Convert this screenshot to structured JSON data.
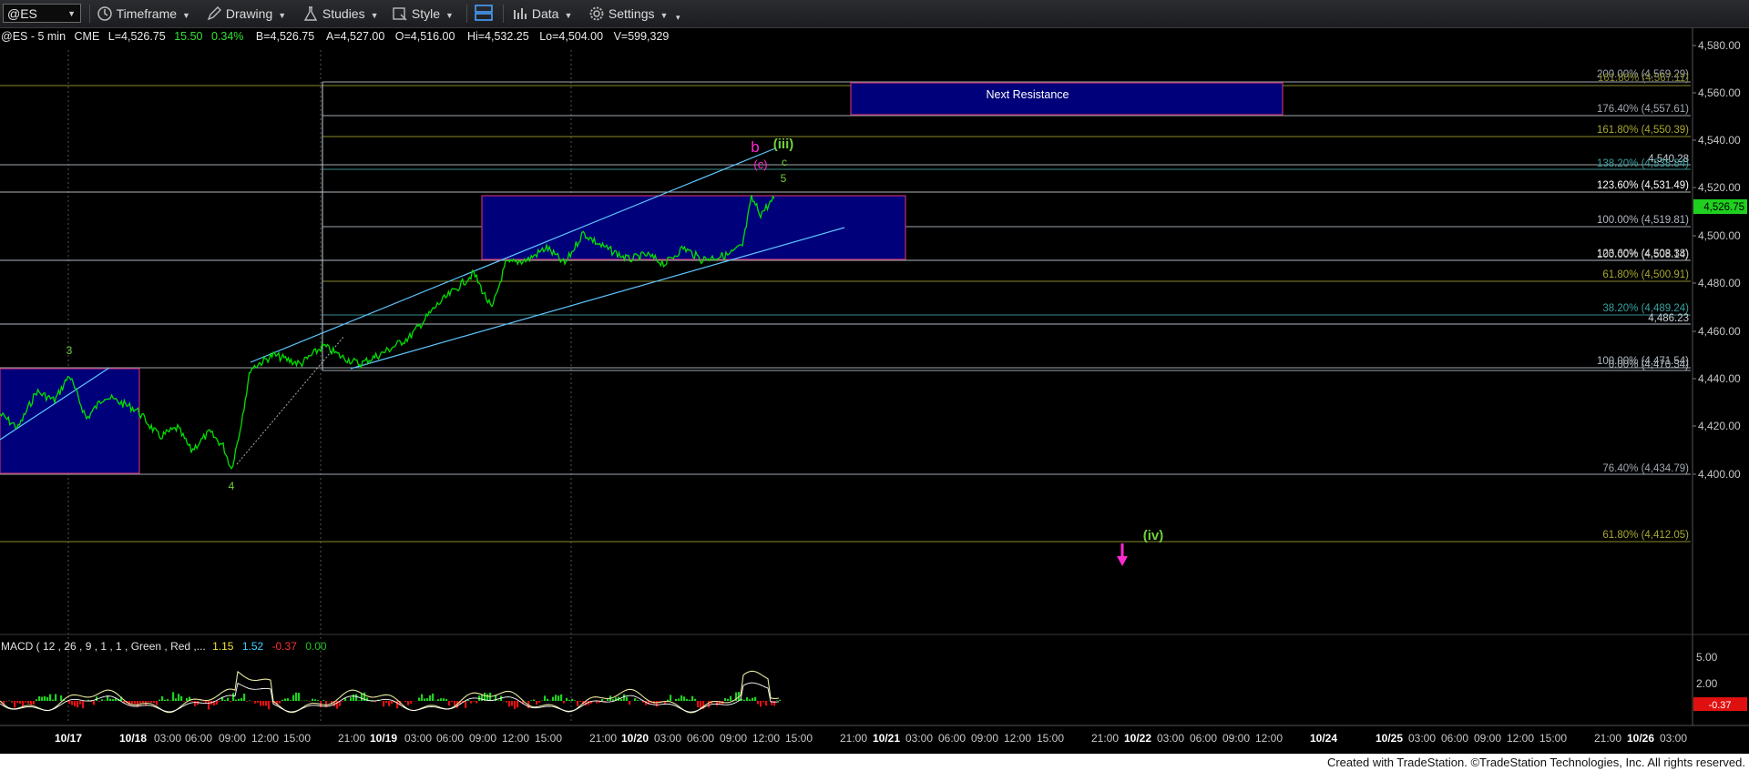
{
  "toolbar": {
    "symbol": "@ES",
    "timeframe": "Timeframe",
    "drawing": "Drawing",
    "studies": "Studies",
    "style": "Style",
    "data": "Data",
    "settings": "Settings"
  },
  "header": {
    "symbol_interval": "@ES - 5 min",
    "exchange": "CME",
    "last": "L=4,526.75",
    "change": "15.50",
    "pct": "0.34%",
    "bid": "B=4,526.75",
    "ask": "A=4,527.00",
    "open": "O=4,516.00",
    "high": "Hi=4,532.25",
    "low": "Lo=4,504.00",
    "volume": "V=599,329"
  },
  "price_axis": {
    "labels": [
      "4,580.00",
      "4,560.00",
      "4,540.00",
      "4,520.00",
      "4,500.00",
      "4,480.00",
      "4,460.00",
      "4,440.00",
      "4,420.00",
      "4,400.00"
    ],
    "current_price": "4,526.75"
  },
  "time_axis": {
    "labels": [
      "10/17",
      "10/18",
      "03:00",
      "06:00",
      "09:00",
      "12:00",
      "15:00",
      "21:00",
      "10/19",
      "03:00",
      "06:00",
      "09:00",
      "12:00",
      "15:00",
      "21:00",
      "10/20",
      "03:00",
      "06:00",
      "09:00",
      "12:00",
      "15:00",
      "21:00",
      "10/21",
      "03:00",
      "06:00",
      "09:00",
      "12:00",
      "15:00",
      "21:00",
      "10/22",
      "03:00",
      "06:00",
      "09:00",
      "12:00",
      "10/24",
      "10/25",
      "03:00",
      "06:00",
      "09:00",
      "12:00",
      "15:00",
      "21:00",
      "10/26",
      "03:00"
    ]
  },
  "fib_labels": [
    {
      "text": "200.00% (4,569.29)"
    },
    {
      "text": "161.80% (4,567.11)"
    },
    {
      "text": "176.40% (4,557.61)"
    },
    {
      "text": "161.80% (4,550.39)"
    },
    {
      "text": "4,540.28"
    },
    {
      "text": "138.20% (4,538.84)"
    },
    {
      "text": "123.60% (4,531.49)"
    },
    {
      "text": "100.00% (4,519.81)"
    },
    {
      "text": "123.60% (4,508.38)"
    },
    {
      "text": "100.00% (4,508.14)"
    },
    {
      "text": "61.80% (4,500.91)"
    },
    {
      "text": "38.20% (4,489.24)"
    },
    {
      "text": "4,486.23"
    },
    {
      "text": "100.00% (4,471.54)"
    },
    {
      "text": "0.00% (4,470.34)"
    },
    {
      "text": "76.40% (4,434.79)"
    },
    {
      "text": "61.80% (4,412.05)"
    }
  ],
  "annotations": {
    "next_resistance": "Next Resistance",
    "wave_3": "3",
    "wave_4": "4",
    "wave_b": "b",
    "wave_iii": "(iii)",
    "wave_c_paren": "(c)",
    "wave_c": "c",
    "wave_5": "5",
    "wave_iv": "(iv)"
  },
  "macd": {
    "label": "MACD ( 12 , 26 , 9 , 1 , 1 , Green , Red ,...",
    "v1": "1.15",
    "v2": "1.52",
    "v3": "-0.37",
    "v4": "0.00",
    "axis": [
      "5.00",
      "2.00"
    ],
    "current": "-0.37"
  },
  "footer": "Created with TradeStation. ©TradeStation Technologies, Inc. All rights reserved.",
  "colors": {
    "price": "#00e000",
    "box_fill": "#00007a",
    "box_border": "#c0306a",
    "fib_line": "#9aaabb",
    "fib_gold": "#8a8a2a",
    "magenta": "#ff29d0",
    "label_green": "#6fd03a"
  }
}
